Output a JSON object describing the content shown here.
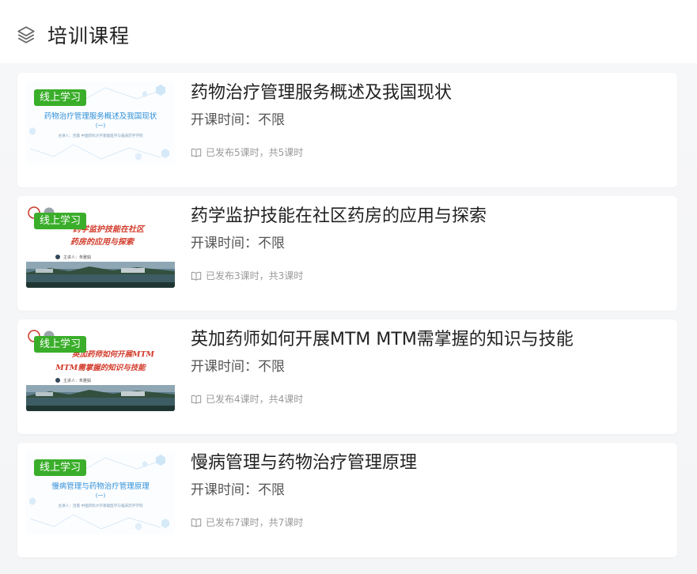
{
  "header": {
    "title": "培训课程",
    "icon": "layers-icon"
  },
  "courses": [
    {
      "tag": "线上学习",
      "title": "药物治疗管理服务概述及我国现状",
      "time_label": "开课时间：",
      "time_value": "不限",
      "published": "已发布5课时，共5课时",
      "thumb_style": "light",
      "thumb_title": "药物治疗管理服务概述及我国现状",
      "thumb_sub": "(一)",
      "thumb_speaker": "主讲人：吕霞  中国药科大学基础医学与临床药学学院"
    },
    {
      "tag": "线上学习",
      "title": "药学监护技能在社区药房的应用与探索",
      "time_label": "开课时间：",
      "time_value": "不限",
      "published": "已发布3课时，共3课时",
      "thumb_style": "campus",
      "thumb_line1": "药学监护技能在社区",
      "thumb_line2": "药房的应用与探索",
      "thumb_speaker": "主讲人：朱雅娟"
    },
    {
      "tag": "线上学习",
      "title": "英加药师如何开展MTM MTM需掌握的知识与技能",
      "time_label": "开课时间：",
      "time_value": "不限",
      "published": "已发布4课时，共4课时",
      "thumb_style": "campus",
      "thumb_line1": "英加药师如何开展MTM",
      "thumb_line2": "MTM需掌握的知识与技能",
      "thumb_speaker": "主讲人：朱雅娟"
    },
    {
      "tag": "线上学习",
      "title": "慢病管理与药物治疗管理原理",
      "time_label": "开课时间：",
      "time_value": "不限",
      "published": "已发布7课时，共7课时",
      "thumb_style": "light",
      "thumb_title": "慢病管理与药物治疗管理原理",
      "thumb_sub": "(一)",
      "thumb_speaker": "主讲人：吕霞  中国药科大学基础医学与临床药学学院"
    }
  ],
  "colors": {
    "tag_bg": "#3aae2a",
    "thumb_blue": "#2f8fd8",
    "thumb_red": "#d23a2a"
  }
}
